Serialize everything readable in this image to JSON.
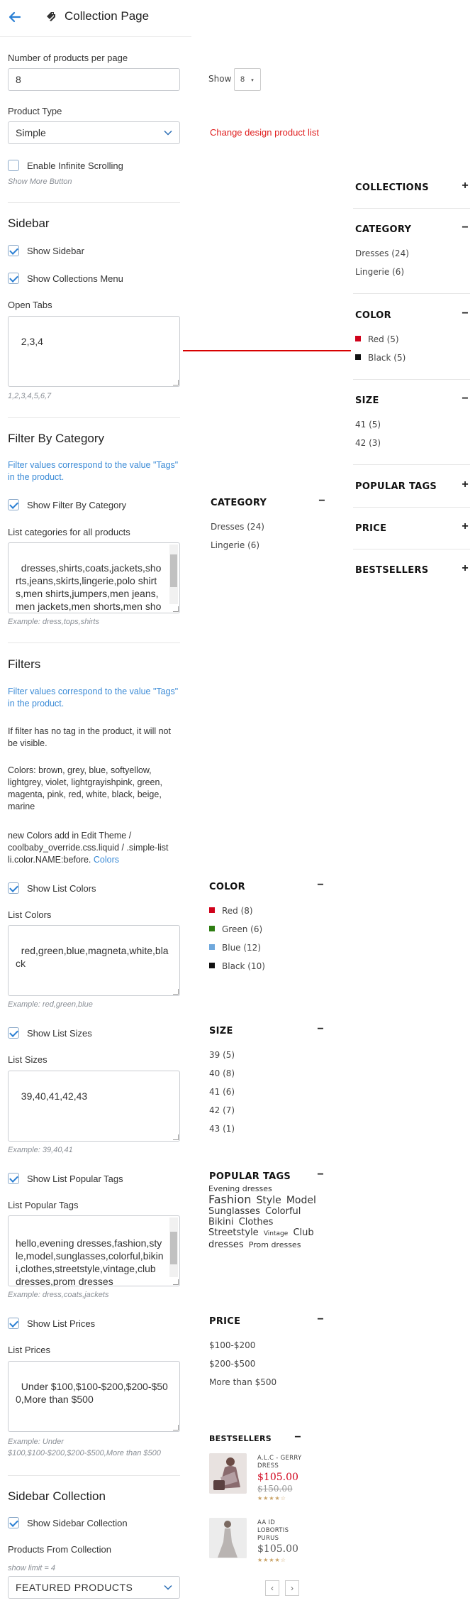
{
  "header": {
    "title": "Collection Page"
  },
  "products_per_page": {
    "label": "Number of products per page",
    "value": "8"
  },
  "show_select": {
    "label": "Show",
    "value": "8"
  },
  "product_type": {
    "label": "Product Type",
    "value": "Simple"
  },
  "change_design": "Change design product list",
  "infinite": {
    "label": "Enable Infinite Scrolling",
    "hint": "Show More Button"
  },
  "sidebar": {
    "title": "Sidebar",
    "show_sidebar": "Show Sidebar",
    "show_collections_menu": "Show Collections Menu",
    "open_tabs_label": "Open Tabs",
    "open_tabs_value": "2,3,4",
    "open_tabs_hint": "1,2,3,4,5,6,7"
  },
  "filter_category": {
    "title": "Filter By Category",
    "note": "Filter values correspond to the value \"Tags\" in the product.",
    "show": "Show Filter By Category",
    "list_label": "List categories for all products",
    "list_value": "dresses,shirts,coats,jackets,shorts,jeans,skirts,lingerie,polo shirts,men shirts,jumpers,men jeans,men jackets,men shorts,men shoes,hoodies",
    "hint": "Example: dress,tops,shirts"
  },
  "filters": {
    "title": "Filters",
    "note": "Filter values correspond to the value \"Tags\" in the product.",
    "note2": "If filter has no tag in the product, it will not be visible.",
    "colors_note": "Colors: brown, grey, blue, softyellow, lightgrey, violet, lightgrayishpink, green, magenta, pink, red, white, black, beige, marine",
    "new_colors_note": "new Colors add in Edit Theme / coolbaby_override.css.liquid / .simple-list li.color.NAME:before.",
    "new_colors_link": "Colors",
    "show_colors": "Show List Colors",
    "colors_label": "List Colors",
    "colors_value": "red,green,blue,magneta,white,black",
    "colors_hint": "Example: red,green,blue",
    "show_sizes": "Show List Sizes",
    "sizes_label": "List Sizes",
    "sizes_value": "39,40,41,42,43",
    "sizes_hint": "Example: 39,40,41",
    "show_tags": "Show List Popular Tags",
    "tags_label": "List Popular Tags",
    "tags_value": "hello,evening dresses,fashion,style,model,sunglasses,colorful,bikini,clothes,streetstyle,vintage,club dresses,prom dresses",
    "tags_hint": "Example: dress,coats,jackets",
    "show_prices": "Show List Prices",
    "prices_label": "List Prices",
    "prices_value": "Under $100,$100-$200,$200-$500,More than $500",
    "prices_hint": "Example: Under $100,$100-$200,$200-$500,More than $500"
  },
  "sidebar_collection": {
    "title": "Sidebar Collection",
    "show": "Show Sidebar Collection",
    "from_label": "Products From Collection",
    "hint": "show limit = 4",
    "value": "FEATURED PRODUCTS"
  },
  "preview_right": {
    "collections": "COLLECTIONS",
    "category": "CATEGORY",
    "category_items": [
      "Dresses (24)",
      "Lingerie (6)"
    ],
    "color": "COLOR",
    "color_items": [
      {
        "name": "Red (5)",
        "color": "#d0021b"
      },
      {
        "name": "Black (5)",
        "color": "#111111"
      }
    ],
    "size": "SIZE",
    "size_items": [
      "41 (5)",
      "42 (3)"
    ],
    "popular_tags": "POPULAR TAGS",
    "price": "PRICE",
    "bestsellers": "BESTSELLERS"
  },
  "preview_center": {
    "category": "CATEGORY",
    "category_items": [
      "Dresses (24)",
      "Lingerie (6)"
    ],
    "color": "COLOR",
    "color_items": [
      {
        "name": "Red (8)",
        "color": "#d0021b"
      },
      {
        "name": "Green (6)",
        "color": "#2e7d12"
      },
      {
        "name": "Blue (12)",
        "color": "#6fa8dc"
      },
      {
        "name": "Black (10)",
        "color": "#111111"
      }
    ],
    "size": "SIZE",
    "size_items": [
      "39 (5)",
      "40 (8)",
      "41 (6)",
      "42 (7)",
      "43 (1)"
    ],
    "popular_tags": "POPULAR TAGS",
    "tags": [
      "Evening dresses",
      "Fashion",
      "Style",
      "Model",
      "Sunglasses",
      "Colorful",
      "Bikini",
      "Clothes",
      "Streetstyle",
      "Vintage",
      "Club",
      "dresses",
      "Prom dresses"
    ],
    "price": "PRICE",
    "price_items": [
      "$100-$200",
      "$200-$500",
      "More than $500"
    ],
    "bestsellers": "BESTSELLERS",
    "products": [
      {
        "name": "A.L.C - GERRY DRESS",
        "price": "$105.00",
        "old_price": "$150.00",
        "price_color": "#d0021b",
        "stars": "★★★★☆"
      },
      {
        "name": "AA ID LOBORTIS PURUS",
        "price": "$105.00",
        "old_price": "",
        "price_color": "#555555",
        "stars": "★★★★☆"
      }
    ],
    "prev": "‹",
    "next": "›"
  }
}
